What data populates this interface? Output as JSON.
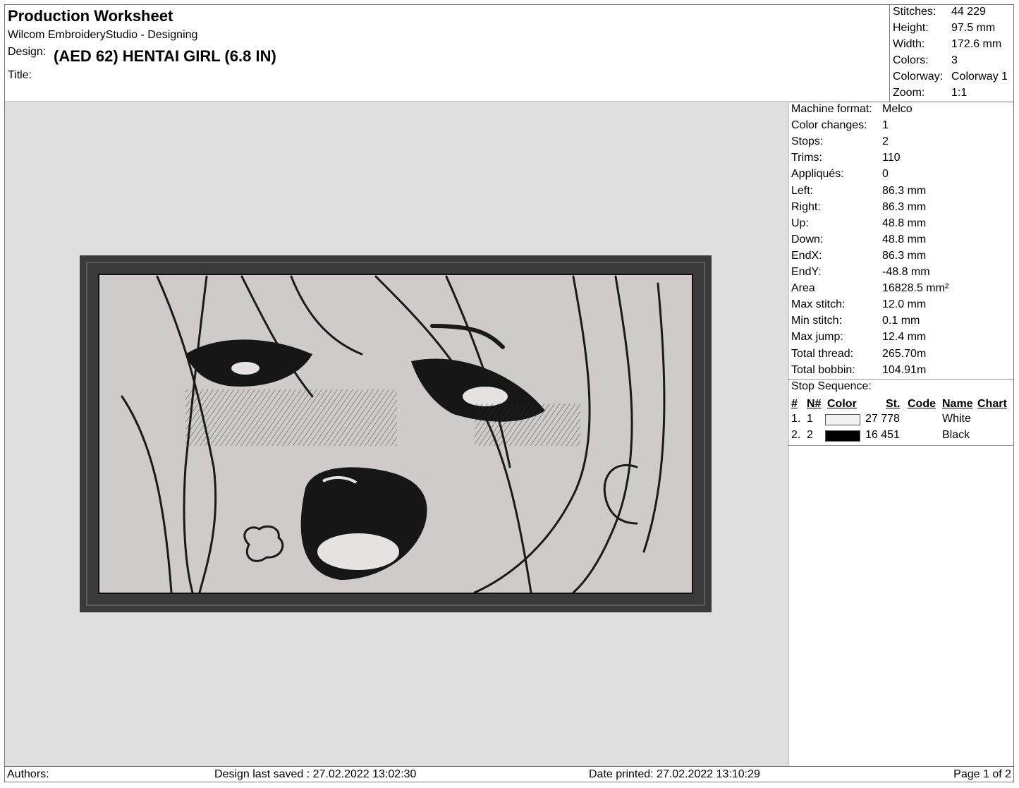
{
  "header": {
    "title": "Production Worksheet",
    "software": "Wilcom EmbroideryStudio - Designing",
    "design_label": "Design:",
    "design_name": "(AED 62) HENTAI GIRL (6.8 IN)",
    "title_label": "Title:"
  },
  "summary": [
    {
      "label": "Stitches:",
      "value": "44 229"
    },
    {
      "label": "Height:",
      "value": "97.5 mm"
    },
    {
      "label": "Width:",
      "value": "172.6 mm"
    },
    {
      "label": "Colors:",
      "value": "3"
    },
    {
      "label": "Colorway:",
      "value": "Colorway 1"
    },
    {
      "label": "Zoom:",
      "value": "1:1"
    }
  ],
  "details": [
    {
      "label": "Machine format:",
      "value": "Melco"
    },
    {
      "label": "Color changes:",
      "value": "1"
    },
    {
      "label": "Stops:",
      "value": "2"
    },
    {
      "label": "Trims:",
      "value": "110"
    },
    {
      "label": "Appliqués:",
      "value": "0"
    },
    {
      "label": "Left:",
      "value": "86.3 mm"
    },
    {
      "label": "Right:",
      "value": "86.3 mm"
    },
    {
      "label": "Up:",
      "value": "48.8 mm"
    },
    {
      "label": "Down:",
      "value": "48.8 mm"
    },
    {
      "label": "EndX:",
      "value": "86.3 mm"
    },
    {
      "label": "EndY:",
      "value": "-48.8 mm"
    },
    {
      "label": "Area",
      "value": "16828.5 mm²"
    },
    {
      "label": "Max stitch:",
      "value": "12.0 mm"
    },
    {
      "label": "Min stitch:",
      "value": "0.1 mm"
    },
    {
      "label": "Max jump:",
      "value": "12.4 mm"
    },
    {
      "label": "Total thread:",
      "value": "265.70m"
    },
    {
      "label": "Total bobbin:",
      "value": "104.91m"
    }
  ],
  "stop_sequence": {
    "label": "Stop Sequence:",
    "headers": {
      "num": "#",
      "n": "N#",
      "color": "Color",
      "st": "St.",
      "code": "Code",
      "name": "Name",
      "chart": "Chart"
    },
    "rows": [
      {
        "num": "1.",
        "n": "1",
        "swatch": "#f2f2f2",
        "st": "27 778",
        "name": "White"
      },
      {
        "num": "2.",
        "n": "2",
        "swatch": "#000000",
        "st": "16 451",
        "name": "Black"
      }
    ]
  },
  "footer": {
    "authors": "Authors:",
    "saved": "Design last saved : 27.02.2022 13:02:30",
    "printed": "Date printed: 27.02.2022 13:10:29",
    "page": "Page 1 of 2"
  },
  "colors": {
    "canvas": "#dfdfdf",
    "patch_fill": "#cfcbcb",
    "border": "#3a3a3a",
    "line": "#1a1a1a"
  }
}
